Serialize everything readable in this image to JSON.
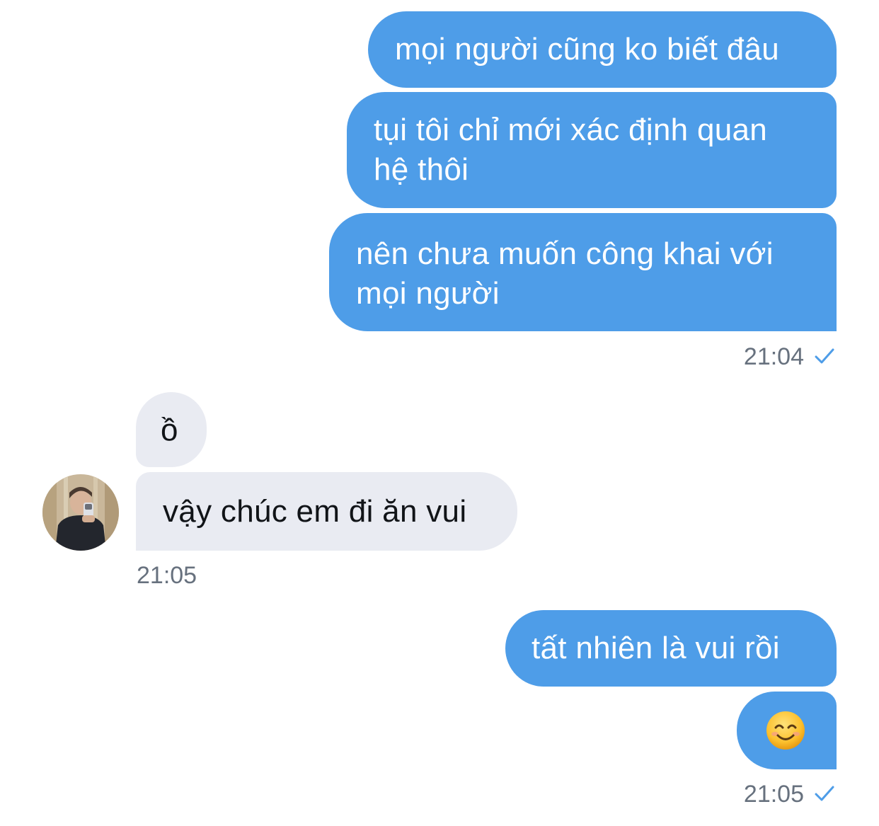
{
  "messages": {
    "m1": "mọi người cũng ko biết đâu",
    "m2": "tụi tôi chỉ mới xác định quan hệ thôi",
    "m3": "nên chưa muốn công khai với mọi người",
    "m4": "ồ",
    "m5": "vậy chúc em đi ăn vui",
    "m6": "tất nhiên là vui rồi",
    "m7_emoji": "smiling-face-with-smiling-eyes"
  },
  "timestamps": {
    "t1": "21:04",
    "t2": "21:05",
    "t3": "21:05"
  },
  "status": {
    "t1_read": "sent-checkmark",
    "t3_read": "sent-checkmark"
  },
  "colors": {
    "outgoing_bubble": "#4e9de8",
    "incoming_bubble": "#e9ebf2",
    "timestamp_text": "#67717e",
    "check_icon": "#4e9de8"
  }
}
